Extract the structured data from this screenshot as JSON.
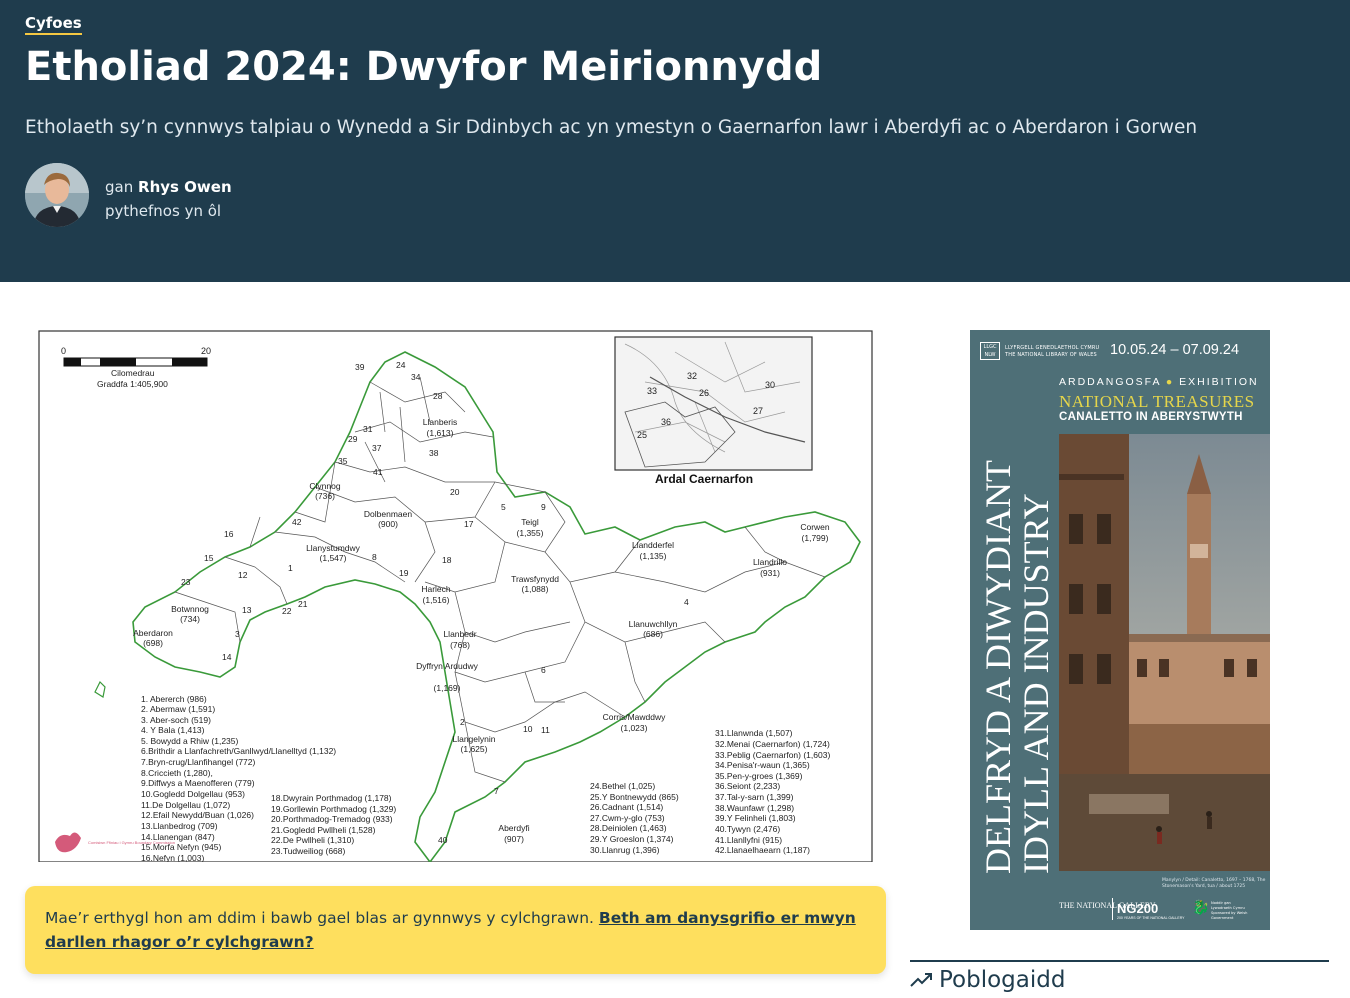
{
  "header": {
    "category": "Cyfoes",
    "title": "Etholiad 2024: Dwyfor Meirionnydd",
    "subtitle": "Etholaeth sy’n cynnwys talpiau o Wynedd a Sir Ddinbych ac yn ymestyn o Gaernarfon lawr i Aberdyfi ac o Aberdaron i Gorwen",
    "by_prefix": "gan",
    "author": "Rhys Owen",
    "time_ago": "pythefnos yn ôl"
  },
  "map": {
    "scale_start": "0",
    "scale_end": "20",
    "scale_unit": "Cilomedrau",
    "scale_ratio": "Graddfa 1:405,900",
    "inset_title": "Ardal Caernarfon",
    "legend_col1": [
      "1. Abererch (986)",
      "2. Abermaw (1,591)",
      "3. Aber-soch (519)",
      "4. Y Bala (1,413)",
      "5. Bowydd a Rhiw (1,235)",
      "6.Brithdir a Llanfachreth/Ganllwyd/Llanelltyd (1,132)",
      "7.Bryn-crug/Llanfihangel (772)",
      "8.Criccieth (1,280),",
      "9.Diffwys a Maenofferen (779)",
      "10.Gogledd Dolgellau (953)",
      "11.De Dolgellau (1,072)",
      "12.Efail Newydd/Buan (1,026)",
      "13.Llanbedrog (709)",
      "14.Llanengan (847)",
      "15.Morfa Nefyn (945)",
      "16.Nefyn (1,003)"
    ],
    "legend_col2": [
      "18.Dwyrain Porthmadog (1,178)",
      "19.Gorllewin Porthmadog (1,329)",
      "20.Porthmadog-Tremadog (933)",
      "21.Gogledd Pwllheli (1,528)",
      "22.De Pwllheli (1,310)",
      "23.Tudweiliog (668)"
    ],
    "legend_col3": [
      "24.Bethel (1,025)",
      "25.Y Bontnewydd (865)",
      "26.Cadnant (1,514)",
      "27.Cwm-y-glo (753)",
      "28.Deiniolen (1,463)",
      "29.Y Groeslon (1,374)",
      "30.Llanrug (1,396)"
    ],
    "legend_col4": [
      "31.Llanwnda (1,507)",
      "32.Menai (Caernarfon) (1,724)",
      "33.Peblig (Caernarfon) (1,603)",
      "34.Penisa'r-waun (1,365)",
      "35.Pen-y-groes (1,369)",
      "36.Seiont (2,233)",
      "37.Tal-y-sarn (1,399)",
      "38.Waunfawr (1,298)",
      "39.Y Felinheli (1,803)",
      "40.Tywyn (2,476)",
      "41.Llanllyfni (915)",
      "42.Llanaelhaearn (1,187)"
    ],
    "places": [
      {
        "name": "Llanberis",
        "count": "(1,613)"
      },
      {
        "name": "Clynnog",
        "count": "(736)"
      },
      {
        "name": "Dolbenmaen",
        "count": "(900)"
      },
      {
        "name": "Llanystumdwy",
        "count": "(1,547)"
      },
      {
        "name": "Teigl",
        "count": "(1,355)"
      },
      {
        "name": "Llandderfel",
        "count": "(1,135)"
      },
      {
        "name": "Corwen",
        "count": "(1,799)"
      },
      {
        "name": "Llandrillo",
        "count": "(931)"
      },
      {
        "name": "Trawsfynydd",
        "count": "(1,088)"
      },
      {
        "name": "Harlech",
        "count": "(1,516)"
      },
      {
        "name": "Botwnnog",
        "count": "(734)"
      },
      {
        "name": "Aberdaron",
        "count": "(698)"
      },
      {
        "name": "Llanuwchllyn",
        "count": "(686)"
      },
      {
        "name": "Llanbedr",
        "count": "(768)"
      },
      {
        "name": "Dyffryn Ardudwy",
        "count": "(1,169)"
      },
      {
        "name": "Corris/Mawddwy",
        "count": "(1,023)"
      },
      {
        "name": "Llangelynin",
        "count": "(1,625)"
      },
      {
        "name": "Aberdyfi",
        "count": "(907)"
      }
    ],
    "commission_logo": "Comisiwn Ffiniau i Gymru Boundary Commission"
  },
  "notice": {
    "text": "Mae’r erthygl hon am ddim i bawb gael blas ar gynnwys y cylchgrawn.",
    "link": "Beth am danysgrifio er mwyn darllen rhagor o’r cylchgrawn?"
  },
  "ad": {
    "org_logo": "LLGC NLW",
    "org_name_cy": "LLYFRGELL GENEDLAETHOL CYMRU",
    "org_name_en": "THE NATIONAL LIBRARY OF WALES",
    "dates": "10.05.24 – 07.09.24",
    "exhibition_cy": "ARDDANGOSFA",
    "exhibition_en": "EXHIBITION",
    "title_yellow": "NATIONAL TREASURES",
    "title_white": "CANALETTO IN ABERYSTWYTH",
    "vertical_1": "DELFRYD A DIWYDIANT",
    "vertical_2": "IDYLL AND INDUSTRY",
    "caption": "Manylyn / Detail: Canaletto, 1697 – 1768, The Stonemason's Yard, tua / about 1725",
    "ng_name": "THE NATIONAL GALLERY",
    "ng200": "NG200",
    "ng200_sub": "200 YEARS OF THE NATIONAL GALLERY",
    "welsh_gov": "Noddir gan Lywodraeth Cymru Sponsored by Welsh Government"
  },
  "sidebar": {
    "popular_title": "Poblogaidd"
  }
}
